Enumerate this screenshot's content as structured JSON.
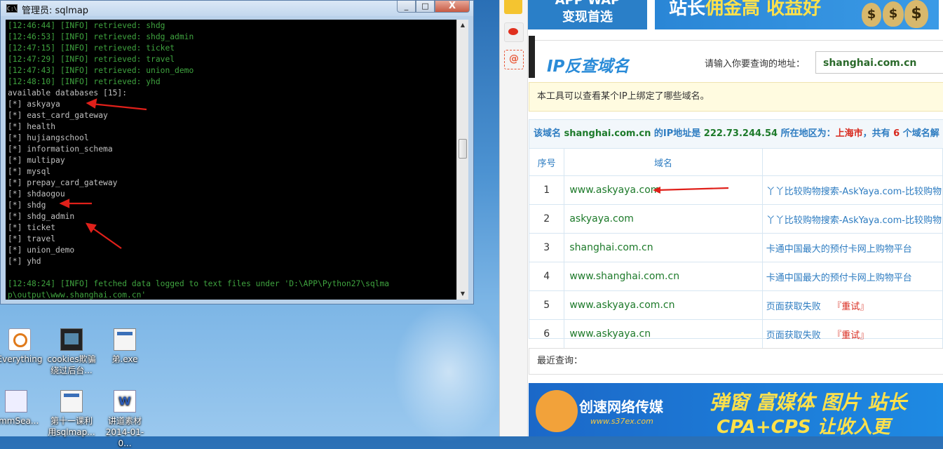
{
  "cmd": {
    "title": "管理员: sqlmap",
    "icon_label": "C:\\",
    "min": "_",
    "max": "□",
    "close": "X",
    "lines": [
      {
        "text": "[12:46:44] [INFO] retrieved: shdg",
        "kind": "info"
      },
      {
        "text": "[12:46:53] [INFO] retrieved: shdg_admin",
        "kind": "info"
      },
      {
        "text": "[12:47:15] [INFO] retrieved: ticket",
        "kind": "info"
      },
      {
        "text": "[12:47:29] [INFO] retrieved: travel",
        "kind": "info"
      },
      {
        "text": "[12:47:43] [INFO] retrieved: union_demo",
        "kind": "info"
      },
      {
        "text": "[12:48:10] [INFO] retrieved: yhd",
        "kind": "info"
      },
      {
        "text": "available databases [15]:",
        "kind": "plain"
      },
      {
        "text": "[*] askyaya",
        "kind": "plain"
      },
      {
        "text": "[*] east_card_gateway",
        "kind": "plain"
      },
      {
        "text": "[*] health",
        "kind": "plain"
      },
      {
        "text": "[*] hujiangschool",
        "kind": "plain"
      },
      {
        "text": "[*] information_schema",
        "kind": "plain"
      },
      {
        "text": "[*] multipay",
        "kind": "plain"
      },
      {
        "text": "[*] mysql",
        "kind": "plain"
      },
      {
        "text": "[*] prepay_card_gateway",
        "kind": "plain"
      },
      {
        "text": "[*] shdaogou",
        "kind": "plain"
      },
      {
        "text": "[*] shdg",
        "kind": "plain"
      },
      {
        "text": "[*] shdg_admin",
        "kind": "plain"
      },
      {
        "text": "[*] ticket",
        "kind": "plain"
      },
      {
        "text": "[*] travel",
        "kind": "plain"
      },
      {
        "text": "[*] union_demo",
        "kind": "plain"
      },
      {
        "text": "[*] yhd",
        "kind": "plain"
      },
      {
        "text": "",
        "kind": "plain"
      },
      {
        "text": "[12:48:24] [INFO] fetched data logged to text files under 'D:\\APP\\Python27\\sqlma",
        "kind": "info"
      },
      {
        "text": "p\\output\\www.shanghai.com.cn'",
        "kind": "info"
      }
    ]
  },
  "desktop_icons": [
    {
      "name": "everything",
      "label": "Everything",
      "icon": "everything-icon"
    },
    {
      "name": "cookies",
      "label": "cookies欺骗绕过后台...",
      "icon": "video-icon"
    },
    {
      "name": "exe",
      "label": "弟.exe",
      "icon": "exe-icon"
    },
    {
      "name": "commsea",
      "label": "ommSea...",
      "icon": "shortcut-icon"
    },
    {
      "name": "lesson11",
      "label": "第十一课利用sqlmap...",
      "icon": "exe-icon"
    },
    {
      "name": "material",
      "label": "讲道素材2014-01-0...",
      "icon": "word-doc-icon"
    }
  ],
  "browser": {
    "ad_top_left_line1": "APP WAP",
    "ad_top_left_line2": "变现首选",
    "ad_top_right_prefix": "站长",
    "ad_top_right_hi": "佣金高 收益好",
    "ad_bag_symbol": "$",
    "page_title": "IP反查域名",
    "addr_label": "请输入你要查询的地址：",
    "addr_value": "shanghai.com.cn",
    "notice": "本工具可以查看某个IP上绑定了哪些域名。",
    "summary": {
      "p1": "该域名 ",
      "domain": "shanghai.com.cn",
      "p2": " 的IP地址是 ",
      "ip": "222.73.244.54",
      "p3": " 所在地区为：",
      "region": "上海市",
      "p4": "，共有 ",
      "count": "6",
      "p5": " 个域名解"
    },
    "table": {
      "col_no": "序号",
      "col_domain": "域名",
      "col_title": "",
      "rows": [
        {
          "no": "1",
          "domain": "www.askyaya.com",
          "title": "丫丫比较购物搜索-AskYaya.com-比较购物",
          "retry": ""
        },
        {
          "no": "2",
          "domain": "askyaya.com",
          "title": "丫丫比较购物搜索-AskYaya.com-比较购物",
          "retry": ""
        },
        {
          "no": "3",
          "domain": "shanghai.com.cn",
          "title": "卡通中国最大的预付卡网上购物平台",
          "retry": ""
        },
        {
          "no": "4",
          "domain": "www.shanghai.com.cn",
          "title": "卡通中国最大的预付卡网上购物平台",
          "retry": ""
        },
        {
          "no": "5",
          "domain": "www.askyaya.com.cn",
          "title": "页面获取失败",
          "retry": "『重试』"
        },
        {
          "no": "6",
          "domain": "www.askyaya.cn",
          "title": "页面获取失败",
          "retry": "『重试』"
        }
      ]
    },
    "recent": "最近查询：",
    "ad_bottom": {
      "brand": "创速网络传媒",
      "url": "www.s37ex.com",
      "slogan1": "弹窗 富媒体 图片 站长",
      "slogan2": "CPA+CPS 让收入更"
    }
  },
  "colors": {
    "info_green": "#3fa33f",
    "link_green": "#1d7a2a",
    "link_blue": "#2d7cc1",
    "alert_red": "#d8281c",
    "annotation_red": "#e0201a"
  }
}
